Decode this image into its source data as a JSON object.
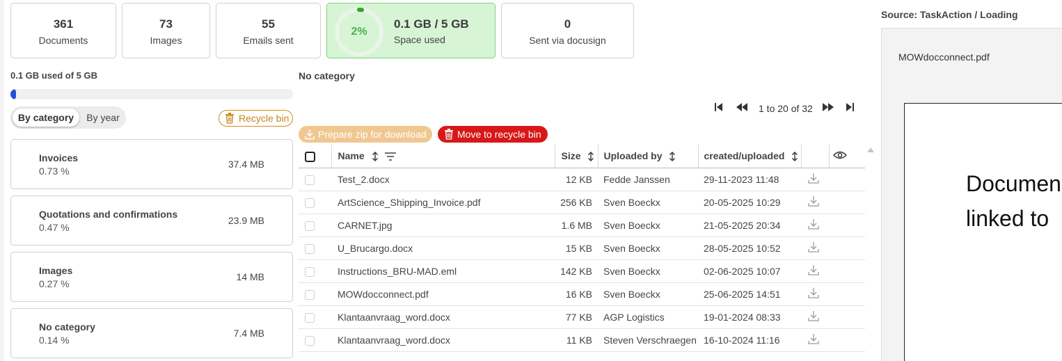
{
  "stats": {
    "documents": {
      "value": "361",
      "label": "Documents"
    },
    "images": {
      "value": "73",
      "label": "Images"
    },
    "emails": {
      "value": "55",
      "label": "Emails sent"
    },
    "space": {
      "percent": "2%",
      "percent_value": 2,
      "value": "0.1 GB / 5 GB",
      "label": "Space used"
    },
    "docusign": {
      "value": "0",
      "label": "Sent via docusign"
    }
  },
  "usage": {
    "label": "0.1 GB used of 5 GB",
    "fraction": 0.02
  },
  "tabs": {
    "by_category": "By category",
    "by_year": "By year",
    "active": "by_category"
  },
  "recycle_bin_label": "Recycle bin",
  "categories": [
    {
      "name": "Invoices",
      "percent": "0.73 %",
      "size": "37.4 MB"
    },
    {
      "name": "Quotations and confirmations",
      "percent": "0.47 %",
      "size": "23.9 MB"
    },
    {
      "name": "Images",
      "percent": "0.27 %",
      "size": "14 MB"
    },
    {
      "name": "No category",
      "percent": "0.14 %",
      "size": "7.4 MB"
    }
  ],
  "main": {
    "title": "No category",
    "pager_text": "1 to 20 of 32",
    "zip_button": "Prepare zip for download",
    "move_button": "Move to recycle bin",
    "columns": {
      "name": "Name",
      "size": "Size",
      "uploaded_by": "Uploaded by",
      "created": "created/uploaded"
    },
    "rows": [
      {
        "name": "Test_2.docx",
        "size": "12 KB",
        "uploaded_by": "Fedde Janssen",
        "created": "29-11-2023 11:48"
      },
      {
        "name": "ArtScience_Shipping_Invoice.pdf",
        "size": "256 KB",
        "uploaded_by": "Sven Boeckx",
        "created": "20-05-2025 10:29"
      },
      {
        "name": "CARNET.jpg",
        "size": "1.6 MB",
        "uploaded_by": "Sven Boeckx",
        "created": "21-05-2025 20:34"
      },
      {
        "name": "U_Brucargo.docx",
        "size": "15 KB",
        "uploaded_by": "Sven Boeckx",
        "created": "28-05-2025 10:52"
      },
      {
        "name": "Instructions_BRU-MAD.eml",
        "size": "142 KB",
        "uploaded_by": "Sven Boeckx",
        "created": "02-06-2025 10:07"
      },
      {
        "name": "MOWdocconnect.pdf",
        "size": "16 KB",
        "uploaded_by": "Sven Boeckx",
        "created": "25-06-2025 14:51"
      },
      {
        "name": "Klantaanvraag_word.docx",
        "size": "77 KB",
        "uploaded_by": "AGP Logistics",
        "created": "19-01-2024 08:33"
      },
      {
        "name": "Klantaanvraag_word.docx",
        "size": "11 KB",
        "uploaded_by": "Steven Verschraegen",
        "created": "16-10-2024 11:16"
      }
    ]
  },
  "preview": {
    "source": "Source: TaskAction / Loading",
    "filename": "MOWdocconnect.pdf",
    "doc_line1": "Documen",
    "doc_line2": "linked to"
  },
  "colors": {
    "space_card_bg": "#d7f5d5",
    "usage_fill": "#2750d8",
    "zip_button": "#f1c791",
    "move_button": "#d81818",
    "recycle_outline": "#d48a18"
  }
}
